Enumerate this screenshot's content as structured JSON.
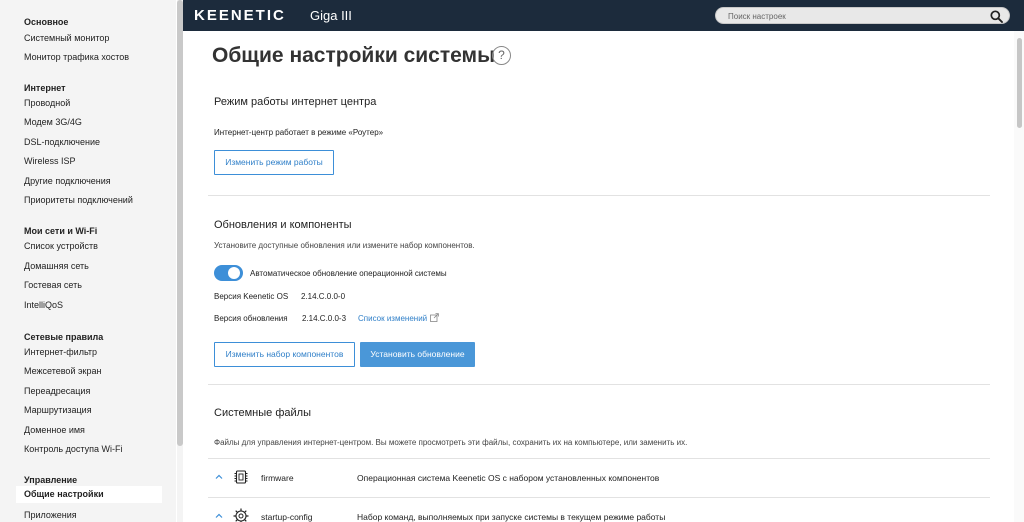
{
  "app": {
    "logo": "KEENETIC",
    "model": "Giga III"
  },
  "search": {
    "placeholder": "Поиск настроек",
    "icon": "search-icon"
  },
  "colors": {
    "header_bg": "#1c2b3c",
    "accent": "#3d8fd8",
    "sidebar_bg": "#f4f4f4"
  },
  "sidebar": {
    "groups": [
      {
        "title": "Основное",
        "items": [
          "Системный монитор",
          "Монитор трафика хостов"
        ]
      },
      {
        "title": "Интернет",
        "items": [
          "Проводной",
          "Модем 3G/4G",
          "DSL-подключение",
          "Wireless ISP",
          "Другие подключения",
          "Приоритеты подключений"
        ]
      },
      {
        "title": "Мои сети и Wi-Fi",
        "items": [
          "Список устройств",
          "Домашняя сеть",
          "Гостевая сеть",
          "IntelliQoS"
        ]
      },
      {
        "title": "Сетевые правила",
        "items": [
          "Интернет-фильтр",
          "Межсетевой экран",
          "Переадресация",
          "Маршрутизация",
          "Доменное имя",
          "Контроль доступа Wi-Fi"
        ]
      },
      {
        "title": "Управление",
        "items": [
          "Общие настройки",
          "Приложения"
        ],
        "active": "Общие настройки"
      }
    ]
  },
  "main": {
    "title": "Общие настройки системы",
    "help_icon": "?",
    "mode": {
      "title": "Режим работы интернет центра",
      "status": "Интернет-центр работает в режиме «Роутер»",
      "button": "Изменить режим работы"
    },
    "updates": {
      "title": "Обновления и компоненты",
      "description": "Установите доступные обновления или измените набор компонентов.",
      "auto_update_label": "Автоматическое обновление операционной системы",
      "auto_update_on": true,
      "os_version_label": "Версия Keenetic OS",
      "os_version": "2.14.C.0.0-0",
      "update_version_label": "Версия обновления",
      "update_version": "2.14.C.0.0-3",
      "changelog_link": "Список изменений",
      "change_components_button": "Изменить набор компонентов",
      "install_button": "Установить обновление"
    },
    "system_files": {
      "title": "Системные файлы",
      "description": "Файлы для управления интернет-центром. Вы можете просмотреть эти файлы, сохранить их на компьютере, или заменить их.",
      "files": [
        {
          "name": "firmware",
          "description": "Операционная система Keenetic OS с набором установленных компонентов",
          "icon": "chip-icon"
        },
        {
          "name": "startup-config",
          "description": "Набор команд, выполняемых при запуске системы в текущем режиме работы",
          "icon": "gear-icon"
        }
      ]
    }
  }
}
